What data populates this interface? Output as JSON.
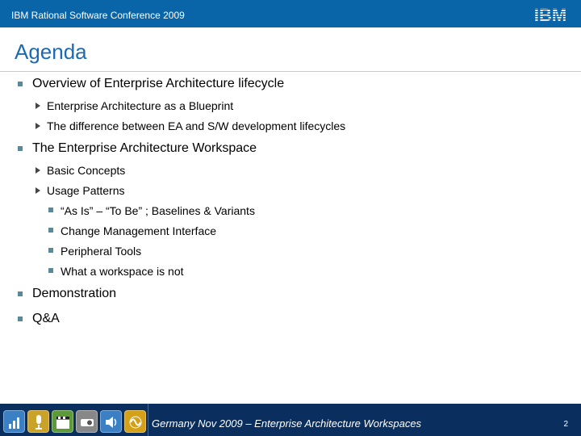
{
  "header": {
    "title": "IBM Rational Software Conference 2009",
    "logo": "IBM",
    "color": "#0a64a8"
  },
  "slide": {
    "title": "Agenda",
    "title_color": "#1d69b4",
    "items": [
      {
        "level": 1,
        "text": "Overview of Enterprise Architecture lifecycle"
      },
      {
        "level": 2,
        "text": "Enterprise Architecture as a Blueprint"
      },
      {
        "level": 2,
        "text": "The difference between EA and S/W development lifecycles"
      },
      {
        "level": 1,
        "text": "The Enterprise Architecture Workspace"
      },
      {
        "level": 2,
        "text": "Basic Concepts"
      },
      {
        "level": 2,
        "text": "Usage Patterns"
      },
      {
        "level": 3,
        "text": "“As Is” – “To Be” ; Baselines & Variants"
      },
      {
        "level": 3,
        "text": "Change Management Interface"
      },
      {
        "level": 3,
        "text": "Peripheral Tools"
      },
      {
        "level": 3,
        "text": "What a workspace is not"
      },
      {
        "level": 1,
        "text": "Demonstration"
      },
      {
        "level": 1,
        "text": "Q&A"
      }
    ]
  },
  "footer": {
    "text": "Germany Nov 2009 – Enterprise Architecture Workspaces",
    "page_number": "2",
    "color": "#0a2f5e",
    "icons": [
      {
        "name": "chart-icon",
        "color": "#3b7fc4"
      },
      {
        "name": "microphone-icon",
        "color": "#c9a227"
      },
      {
        "name": "clapperboard-icon",
        "color": "#5d9a3a"
      },
      {
        "name": "projector-icon",
        "color": "#888888"
      },
      {
        "name": "speaker-icon",
        "color": "#3b7fc4"
      },
      {
        "name": "sound-wave-icon",
        "color": "#d4a017"
      }
    ]
  }
}
